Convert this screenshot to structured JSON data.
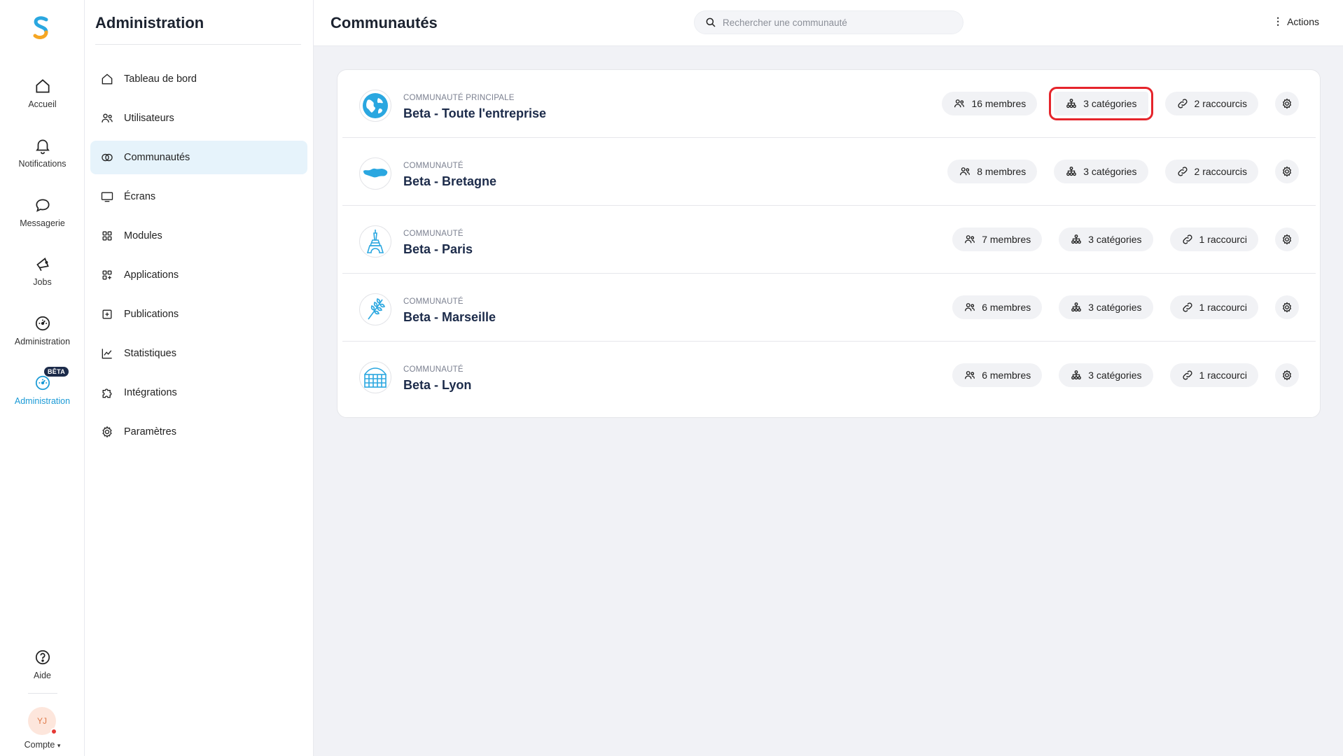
{
  "rail": {
    "items": [
      {
        "label": "Accueil",
        "icon": "home-icon"
      },
      {
        "label": "Notifications",
        "icon": "bell-icon"
      },
      {
        "label": "Messagerie",
        "icon": "chat-icon"
      },
      {
        "label": "Jobs",
        "icon": "megaphone-icon"
      },
      {
        "label": "Administration",
        "icon": "gauge-icon"
      },
      {
        "label": "Administration",
        "icon": "gauge-icon",
        "badge": "BÊTA"
      }
    ],
    "help": "Aide",
    "avatar_initials": "YJ",
    "account": "Compte"
  },
  "sidebar": {
    "title": "Administration",
    "items": [
      {
        "label": "Tableau de bord",
        "icon": "home-icon"
      },
      {
        "label": "Utilisateurs",
        "icon": "users-icon"
      },
      {
        "label": "Communautés",
        "icon": "communities-icon"
      },
      {
        "label": "Écrans",
        "icon": "monitor-icon"
      },
      {
        "label": "Modules",
        "icon": "grid-icon"
      },
      {
        "label": "Applications",
        "icon": "apps-icon"
      },
      {
        "label": "Publications",
        "icon": "plus-square-icon"
      },
      {
        "label": "Statistiques",
        "icon": "chart-icon"
      },
      {
        "label": "Intégrations",
        "icon": "puzzle-icon"
      },
      {
        "label": "Paramètres",
        "icon": "gear-icon"
      }
    ]
  },
  "header": {
    "title": "Communautés",
    "search_placeholder": "Rechercher une communauté",
    "actions_label": "Actions"
  },
  "communities": [
    {
      "type": "Communauté principale",
      "name": "Beta - Toute l'entreprise",
      "members": "16 membres",
      "categories": "3 catégories",
      "shortcuts": "2 raccourcis",
      "icon": "globe-icon"
    },
    {
      "type": "Communauté",
      "name": "Beta - Bretagne",
      "members": "8 membres",
      "categories": "3 catégories",
      "shortcuts": "2 raccourcis",
      "icon": "brittany-map-icon"
    },
    {
      "type": "Communauté",
      "name": "Beta - Paris",
      "members": "7 membres",
      "categories": "3 catégories",
      "shortcuts": "1 raccourci",
      "icon": "eiffel-tower-icon"
    },
    {
      "type": "Communauté",
      "name": "Beta - Marseille",
      "members": "6 membres",
      "categories": "3 catégories",
      "shortcuts": "1 raccourci",
      "icon": "wheat-icon"
    },
    {
      "type": "Communauté",
      "name": "Beta - Lyon",
      "members": "6 membres",
      "categories": "3 catégories",
      "shortcuts": "1 raccourci",
      "icon": "building-icon"
    }
  ],
  "colors": {
    "accent": "#1a9ad6",
    "title": "#1c2b4a",
    "highlight": "#e5242b"
  }
}
